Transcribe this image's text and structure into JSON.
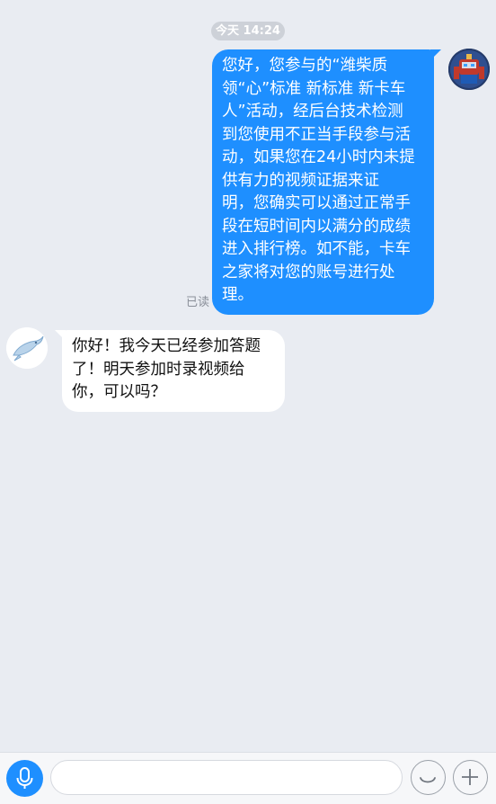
{
  "chat": {
    "time_label": "今天 14:24",
    "messages": [
      {
        "direction": "outgoing",
        "lines": [
          "您好，您参与的“潍柴质",
          "领“心”标准 新标准 新卡车",
          "人”活动，经后台技术检测",
          "到您使用不正当手段参与活",
          "动，如果您在24小时内未提",
          "供有力的视频证据来证",
          "明，您确实可以通过正常手",
          "段在短时间内以满分的成绩",
          "进入排行榜。如不能，卡车",
          "之家将对您的账号进行处",
          "理。"
        ],
        "status": "已读"
      },
      {
        "direction": "incoming",
        "lines": [
          "你好！我今天已经参加答题",
          "了！明天参加时录视频给",
          "你，可以吗？"
        ]
      }
    ]
  },
  "input_bar": {
    "text_value": "",
    "mic_icon": "microphone-icon",
    "emoji_icon": "smiley-icon",
    "plus_icon": "plus-icon"
  },
  "colors": {
    "accent": "#1e8fff",
    "chat_background": "#e9ecf2",
    "incoming_bubble": "#ffffff",
    "time_pill": "#cdd1d8"
  }
}
